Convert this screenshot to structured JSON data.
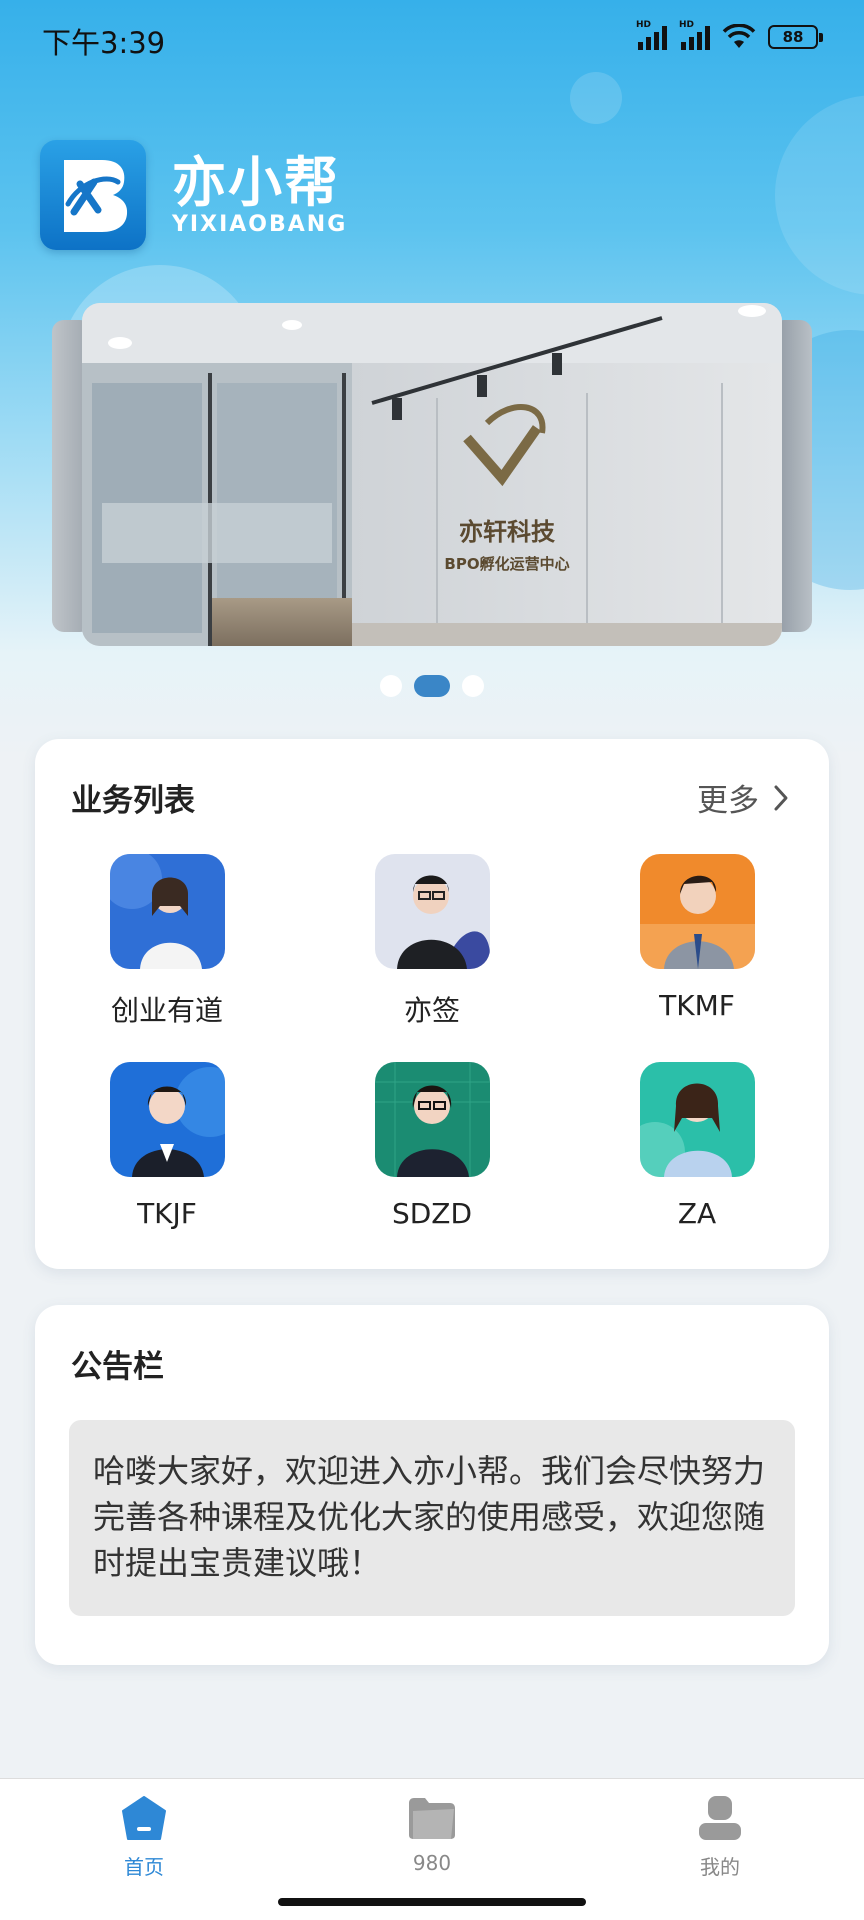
{
  "status_bar": {
    "time": "下午3:39",
    "signal1_label": "HD",
    "signal2_label": "HD",
    "battery": "88"
  },
  "brand": {
    "name_cn": "亦小帮",
    "name_en": "YIXIAOBANG"
  },
  "banner": {
    "slides": 3,
    "active_index": 1,
    "image_text": {
      "company": "亦轩科技",
      "subtitle": "BPO孵化运营中心"
    }
  },
  "business": {
    "title": "业务列表",
    "more_label": "更多",
    "items": [
      {
        "label": "创业有道",
        "color": "#2f6fd6"
      },
      {
        "label": "亦签",
        "color": "#8a93b5"
      },
      {
        "label": "TKMF",
        "color": "#f08a2c"
      },
      {
        "label": "TKJF",
        "color": "#1f6fd8"
      },
      {
        "label": "SDZD",
        "color": "#1b8c72"
      },
      {
        "label": "ZA",
        "color": "#2bbfa9"
      }
    ]
  },
  "notice": {
    "title": "公告栏",
    "content": "哈喽大家好，欢迎进入亦小帮。我们会尽快努力完善各种课程及优化大家的使用感受，欢迎您随时提出宝贵建议哦！"
  },
  "nav": {
    "items": [
      {
        "label": "首页",
        "icon": "home-icon",
        "active": true
      },
      {
        "label": "980",
        "icon": "folder-icon",
        "active": false
      },
      {
        "label": "我的",
        "icon": "user-icon",
        "active": false
      }
    ]
  },
  "colors": {
    "accent": "#2e88d6",
    "hero_top": "#36b0ea",
    "dot_active": "#3a86c7"
  }
}
